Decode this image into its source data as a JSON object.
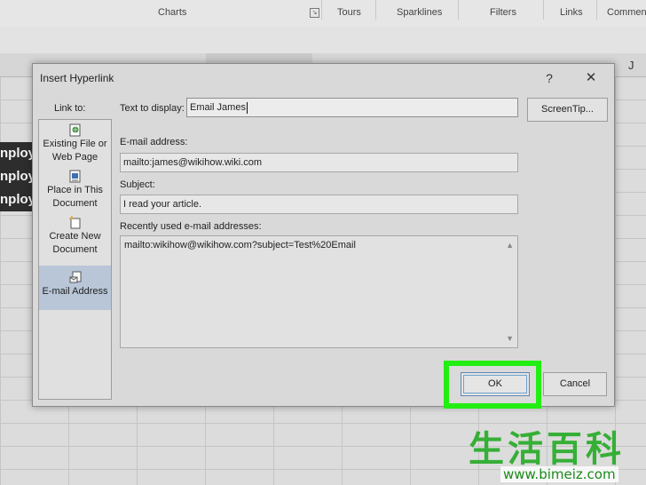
{
  "ribbon": {
    "groups": [
      "Charts",
      "Tours",
      "Sparklines",
      "Filters",
      "Links",
      "Commen"
    ]
  },
  "sheet": {
    "column_letter": "J",
    "cells": [
      "nploy",
      "nploy",
      "nploy"
    ]
  },
  "dialog": {
    "title": "Insert Hyperlink",
    "help_glyph": "?",
    "close_glyph": "✕",
    "link_to_label": "Link to:",
    "link_to_items": [
      {
        "label": "Existing File or Web Page",
        "icon": "existing-file-icon"
      },
      {
        "label": "Place in This Document",
        "icon": "place-in-document-icon"
      },
      {
        "label": "Create New Document",
        "icon": "create-new-document-icon"
      },
      {
        "label": "E-mail Address",
        "icon": "email-address-icon",
        "selected": true
      }
    ],
    "text_to_display_label": "Text to display:",
    "text_to_display_value": "Email James",
    "screentip_label": "ScreenTip...",
    "email_label": "E-mail address:",
    "email_value": "mailto:james@wikihow.wiki.com",
    "subject_label": "Subject:",
    "subject_value": "I read your article.",
    "recent_label": "Recently used e-mail addresses:",
    "recent_items": [
      "mailto:wikihow@wikihow.com?subject=Test%20Email"
    ],
    "ok_label": "OK",
    "cancel_label": "Cancel"
  },
  "watermark": {
    "chinese": "生活百科",
    "url": "www.bimeiz.com"
  },
  "colors": {
    "highlight": "#22ee12",
    "selected_item": "#b8c6d8",
    "dialog_bg": "#d9d9d9"
  }
}
